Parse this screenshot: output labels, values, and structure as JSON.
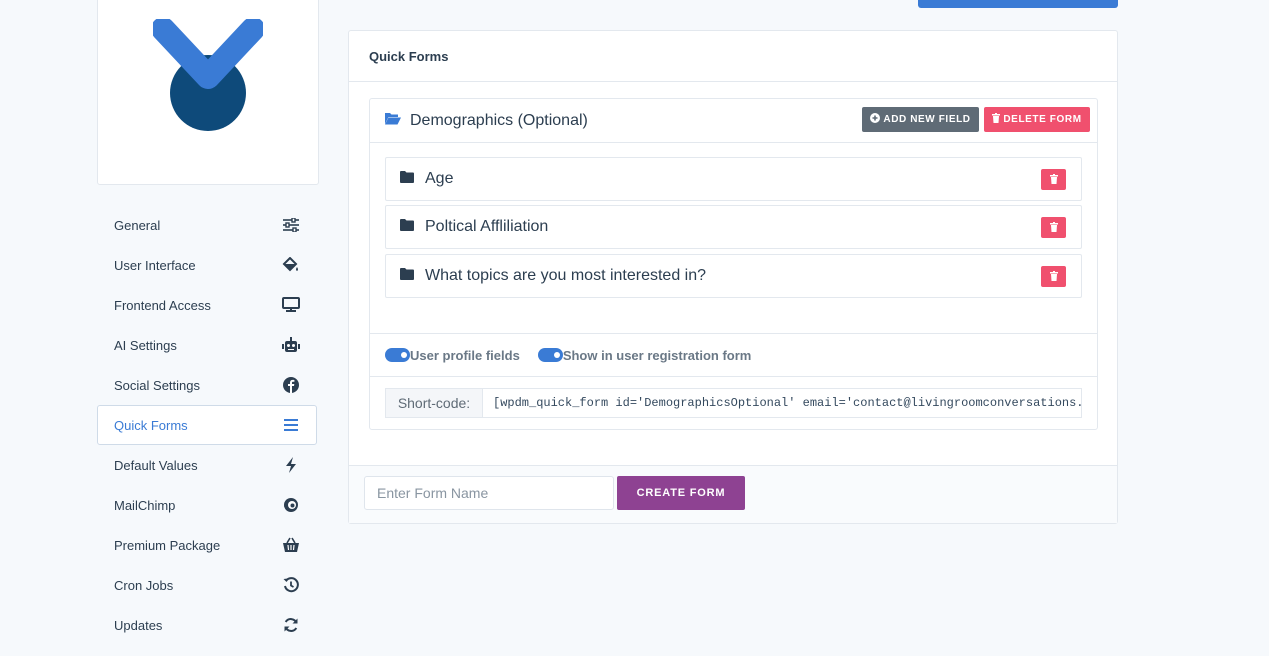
{
  "sidebar": {
    "items": [
      {
        "label": "General",
        "icon": "sliders-icon"
      },
      {
        "label": "User Interface",
        "icon": "paint-bucket-icon"
      },
      {
        "label": "Frontend Access",
        "icon": "desktop-icon"
      },
      {
        "label": "AI Settings",
        "icon": "robot-icon"
      },
      {
        "label": "Social Settings",
        "icon": "facebook-icon"
      },
      {
        "label": "Quick Forms",
        "icon": "list-icon",
        "active": true
      },
      {
        "label": "Default Values",
        "icon": "bolt-icon"
      },
      {
        "label": "MailChimp",
        "icon": "mailchimp-icon"
      },
      {
        "label": "Premium Package",
        "icon": "basket-icon"
      },
      {
        "label": "Cron Jobs",
        "icon": "history-icon"
      },
      {
        "label": "Updates",
        "icon": "sync-icon"
      }
    ]
  },
  "panel": {
    "title": "Quick Forms"
  },
  "form": {
    "name": "Demographics (Optional)",
    "add_field_label": "ADD NEW FIELD",
    "delete_form_label": "DELETE FORM",
    "fields": [
      {
        "label": "Age"
      },
      {
        "label": "Poltical Affliliation"
      },
      {
        "label": "What topics are you most interested in?"
      }
    ],
    "toggles": {
      "profile_label": "User profile fields",
      "registration_label": "Show in user registration form"
    },
    "shortcode_label": "Short-code:",
    "shortcode_value": "[wpdm_quick_form id='DemographicsOptional' email='contact@livingroomconversations.org']"
  },
  "footer": {
    "placeholder": "Enter Form Name",
    "create_label": "CREATE FORM"
  },
  "colors": {
    "primary": "#3a7bd5",
    "danger": "#f0506e",
    "create": "#8e4292",
    "logo_dark": "#0e4a7a"
  }
}
